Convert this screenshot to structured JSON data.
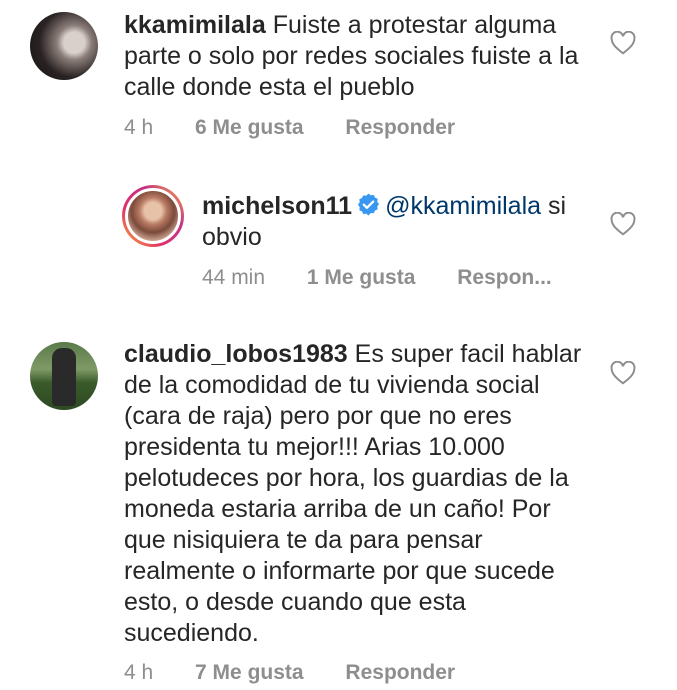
{
  "comments": [
    {
      "username": "kkamimilala",
      "text": "Fuiste a protestar alguma parte o solo por redes sociales fuiste a la calle donde esta el pueblo",
      "time": "4 h",
      "likes": "6 Me gusta",
      "reply": "Responder"
    },
    {
      "username": "michelson11",
      "verified": true,
      "mention": "@kkamimilala",
      "text": "si obvio",
      "time": "44 min",
      "likes": "1 Me gusta",
      "reply": "Respon..."
    },
    {
      "username": "claudio_lobos1983",
      "text": "Es super facil hablar de la comodidad de tu vivienda social (cara de raja) pero por que no eres presidenta tu mejor!!! Arias 10.000 pelotudeces por hora, los guardias de la moneda estaria arriba de un caño! Por que nisiquiera te da para pensar realmente o informarte por que sucede esto, o desde cuando que esta sucediendo.",
      "time": "4 h",
      "likes": "7 Me gusta",
      "reply": "Responder"
    }
  ],
  "colors": {
    "text": "#262626",
    "meta": "#8e8e8e",
    "mention": "#00376b",
    "verified": "#3897f0"
  },
  "icons": {
    "like": "heart-outline-icon",
    "verified": "verified-badge-icon"
  }
}
